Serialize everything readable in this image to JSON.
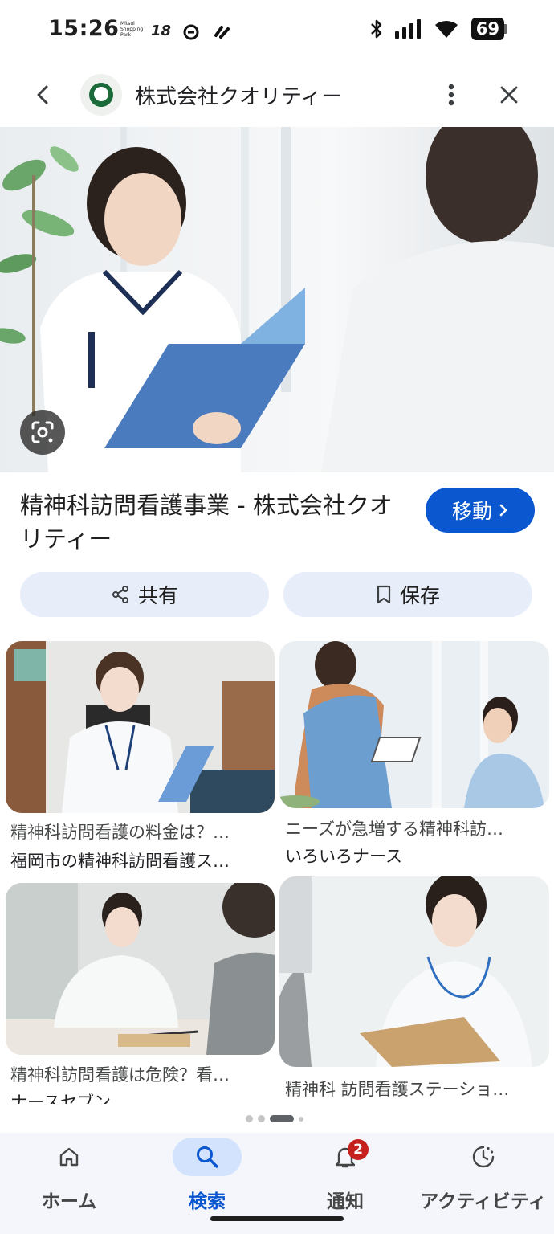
{
  "status_bar": {
    "time": "15:26",
    "app_indicator_1": "Mitsui Shopping Park",
    "app_indicator_2": "18",
    "battery": "69"
  },
  "header": {
    "site_name": "株式会社クオリティー"
  },
  "result": {
    "title": "精神科訪問看護事業 - 株式会社クオリティー",
    "visit_label": "移動",
    "share_label": "共有",
    "save_label": "保存"
  },
  "related": [
    {
      "title": "精神科訪問看護の料金は？…",
      "source": "福岡市の精神科訪問看護ス…"
    },
    {
      "title": "ニーズが急増する精神科訪…",
      "source": "いろいろナース"
    },
    {
      "title": "精神科訪問看護は危険？看…",
      "source": "ナースセブン"
    },
    {
      "title": "精神科 訪問看護ステーショ…",
      "source": ""
    }
  ],
  "bottom_nav": {
    "home": "ホーム",
    "search": "検索",
    "notifications": "通知",
    "notifications_badge": "2",
    "activity": "アクティビティ"
  },
  "colors": {
    "accent": "#0b57d0",
    "chip_bg": "#e8eef9",
    "nav_active_bg": "#d3e3fd",
    "badge": "#c5221f"
  }
}
